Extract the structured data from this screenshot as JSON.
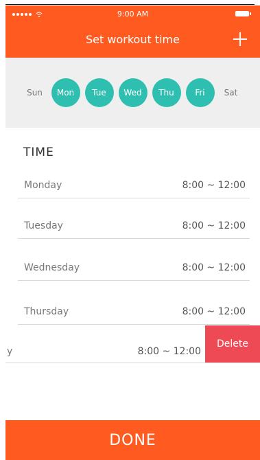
{
  "status_bar": {
    "time": "9:00 AM"
  },
  "header": {
    "title": "Set workout time",
    "add_icon": "plus-icon"
  },
  "days": [
    {
      "label": "Sun",
      "selected": false
    },
    {
      "label": "Mon",
      "selected": true
    },
    {
      "label": "Tue",
      "selected": true
    },
    {
      "label": "Wed",
      "selected": true
    },
    {
      "label": "Thu",
      "selected": true
    },
    {
      "label": "Fri",
      "selected": true
    },
    {
      "label": "Sat",
      "selected": false
    }
  ],
  "time_section": {
    "title": "TIME",
    "rows": [
      {
        "day": "Monday",
        "range": "8:00 ~ 12:00"
      },
      {
        "day": "Tuesday",
        "range": "8:00 ~ 12:00"
      },
      {
        "day": "Wednesday",
        "range": "8:00 ~ 12:00"
      },
      {
        "day": "Thursday",
        "range": "8:00 ~ 12:00"
      }
    ],
    "swiped_row": {
      "day": "y",
      "range": "8:00 ~ 12:00",
      "delete_label": "Delete"
    }
  },
  "footer": {
    "done_label": "DONE"
  },
  "colors": {
    "accent": "#ff5a1f",
    "teal": "#2fbfb0",
    "delete": "#ee4a56"
  }
}
